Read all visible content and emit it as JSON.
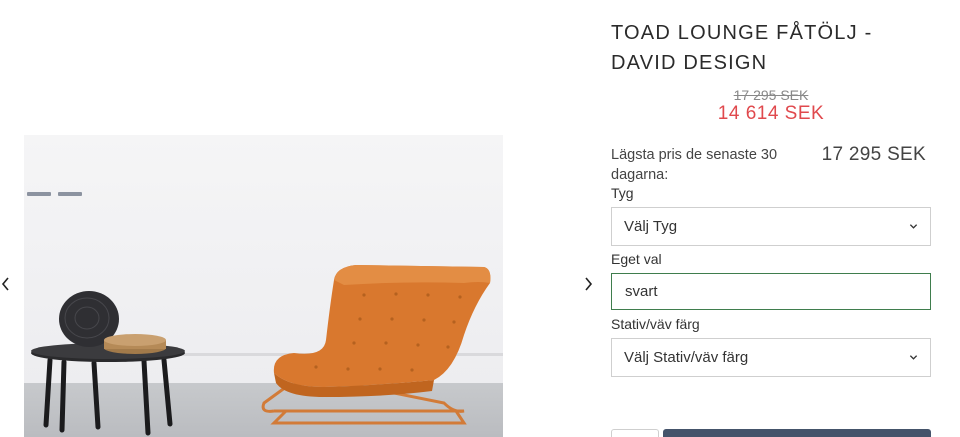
{
  "product": {
    "title": "TOAD LOUNGE FÅTÖLJ - DAVID DESIGN",
    "old_price": "17 295 SEK",
    "new_price": "14 614 SEK",
    "lowest_price_label": "Lägsta pris de senaste 30 dagarna:",
    "lowest_price_value": "17 295 SEK"
  },
  "options": {
    "fabric": {
      "label": "Tyg",
      "selected": "Välj Tyg"
    },
    "custom": {
      "label": "Eget val",
      "value": "svart"
    },
    "frame": {
      "label": "Stativ/väv färg",
      "selected": "Välj Stativ/väv färg"
    }
  },
  "icons": {
    "prev": "chevron-left-icon",
    "next": "chevron-right-icon",
    "dropdown": "chevron-down-icon"
  },
  "colors": {
    "sale_price": "#e0494d",
    "input_focus_border": "#3f7d4d",
    "buy_button": "#44536a",
    "chair": "#d9782e"
  }
}
